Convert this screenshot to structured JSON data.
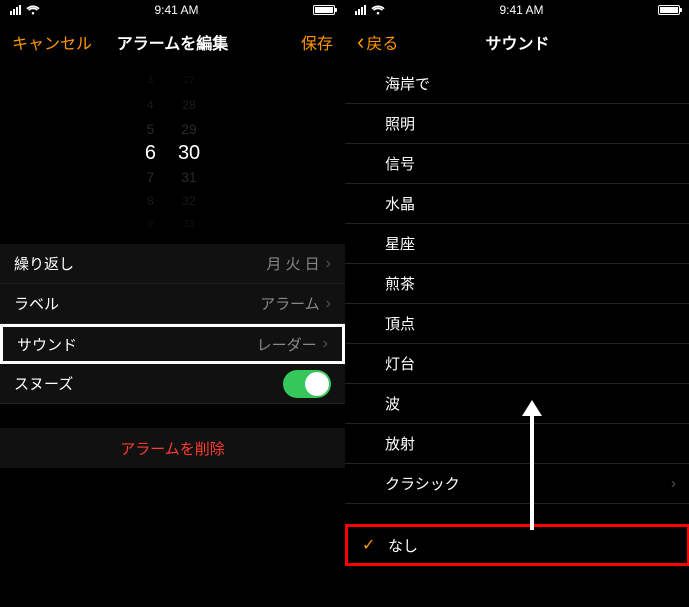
{
  "status": {
    "time": "9:41 AM"
  },
  "left": {
    "nav": {
      "cancel": "キャンセル",
      "title": "アラームを編集",
      "save": "保存"
    },
    "picker": {
      "hours": [
        "3",
        "4",
        "5",
        "6",
        "7",
        "8",
        "9"
      ],
      "mins": [
        "27",
        "28",
        "29",
        "30",
        "31",
        "32",
        "33"
      ]
    },
    "rows": {
      "repeat": {
        "label": "繰り返し",
        "value": "月 火 日"
      },
      "label": {
        "label": "ラベル",
        "value": "アラーム"
      },
      "sound": {
        "label": "サウンド",
        "value": "レーダー"
      },
      "snooze": {
        "label": "スヌーズ"
      }
    },
    "delete": "アラームを削除"
  },
  "right": {
    "nav": {
      "back": "戻る",
      "title": "サウンド"
    },
    "items": [
      {
        "label": "海岸で"
      },
      {
        "label": "照明"
      },
      {
        "label": "信号"
      },
      {
        "label": "水晶"
      },
      {
        "label": "星座"
      },
      {
        "label": "煎茶"
      },
      {
        "label": "頂点"
      },
      {
        "label": "灯台"
      },
      {
        "label": "波"
      },
      {
        "label": "放射"
      },
      {
        "label": "クラシック",
        "disclosure": true
      }
    ],
    "none": {
      "label": "なし",
      "checked": true
    }
  }
}
